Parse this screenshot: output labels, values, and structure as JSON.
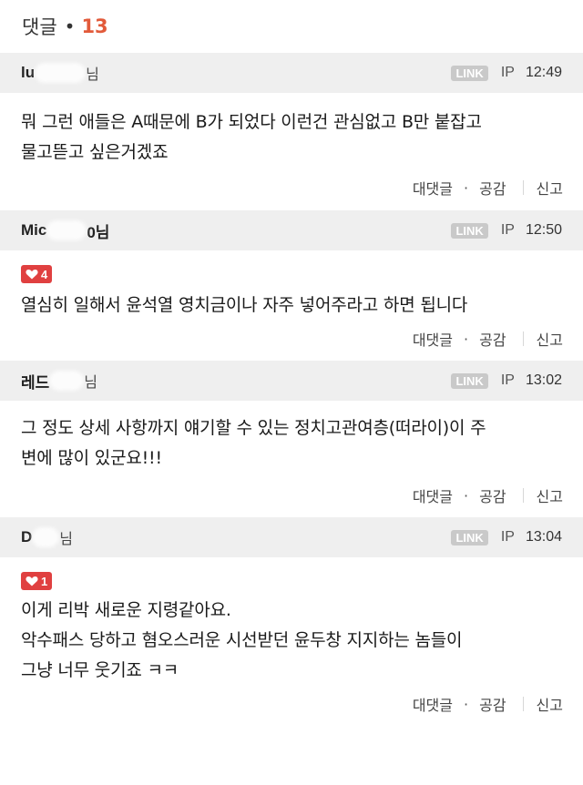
{
  "header": {
    "title": "댓글",
    "dot": "•",
    "count": "13"
  },
  "link_label": "LINK",
  "ip_label": "IP",
  "actions": {
    "reply": "대댓글",
    "dot": "·",
    "like": "공감",
    "report": "신고"
  },
  "colors": {
    "accent": "#e25a3a",
    "like_badge": "#e04040",
    "header_bg": "#efefef"
  },
  "comments": [
    {
      "author_prefix": "lu",
      "author_suffix": "님",
      "time": "12:49",
      "likes": null,
      "lines": [
        "뭐 그런 애들은 A때문에 B가 되었다 이런건 관심없고 B만 붙잡고",
        "물고뜯고 싶은거겠죠"
      ]
    },
    {
      "author_prefix": "Mic",
      "author_suffix": "0님",
      "time": "12:50",
      "likes": "4",
      "lines": [
        "열심히 일해서 윤석열 영치금이나 자주 넣어주라고 하면 됩니다"
      ]
    },
    {
      "author_prefix": "레드",
      "author_suffix": "님",
      "time": "13:02",
      "likes": null,
      "lines": [
        "그 정도 상세 사항까지 얘기할 수 있는 정치고관여층(떠라이)이 주",
        "변에 많이 있군요!!!"
      ]
    },
    {
      "author_prefix": "D",
      "author_suffix": "님",
      "time": "13:04",
      "likes": "1",
      "lines": [
        "이게 리박 새로운 지령같아요.",
        "악수패스 당하고 혐오스러운 시선받던 윤두창 지지하는 놈들이",
        "그냥 너무 웃기죠 ㅋㅋ"
      ]
    }
  ]
}
